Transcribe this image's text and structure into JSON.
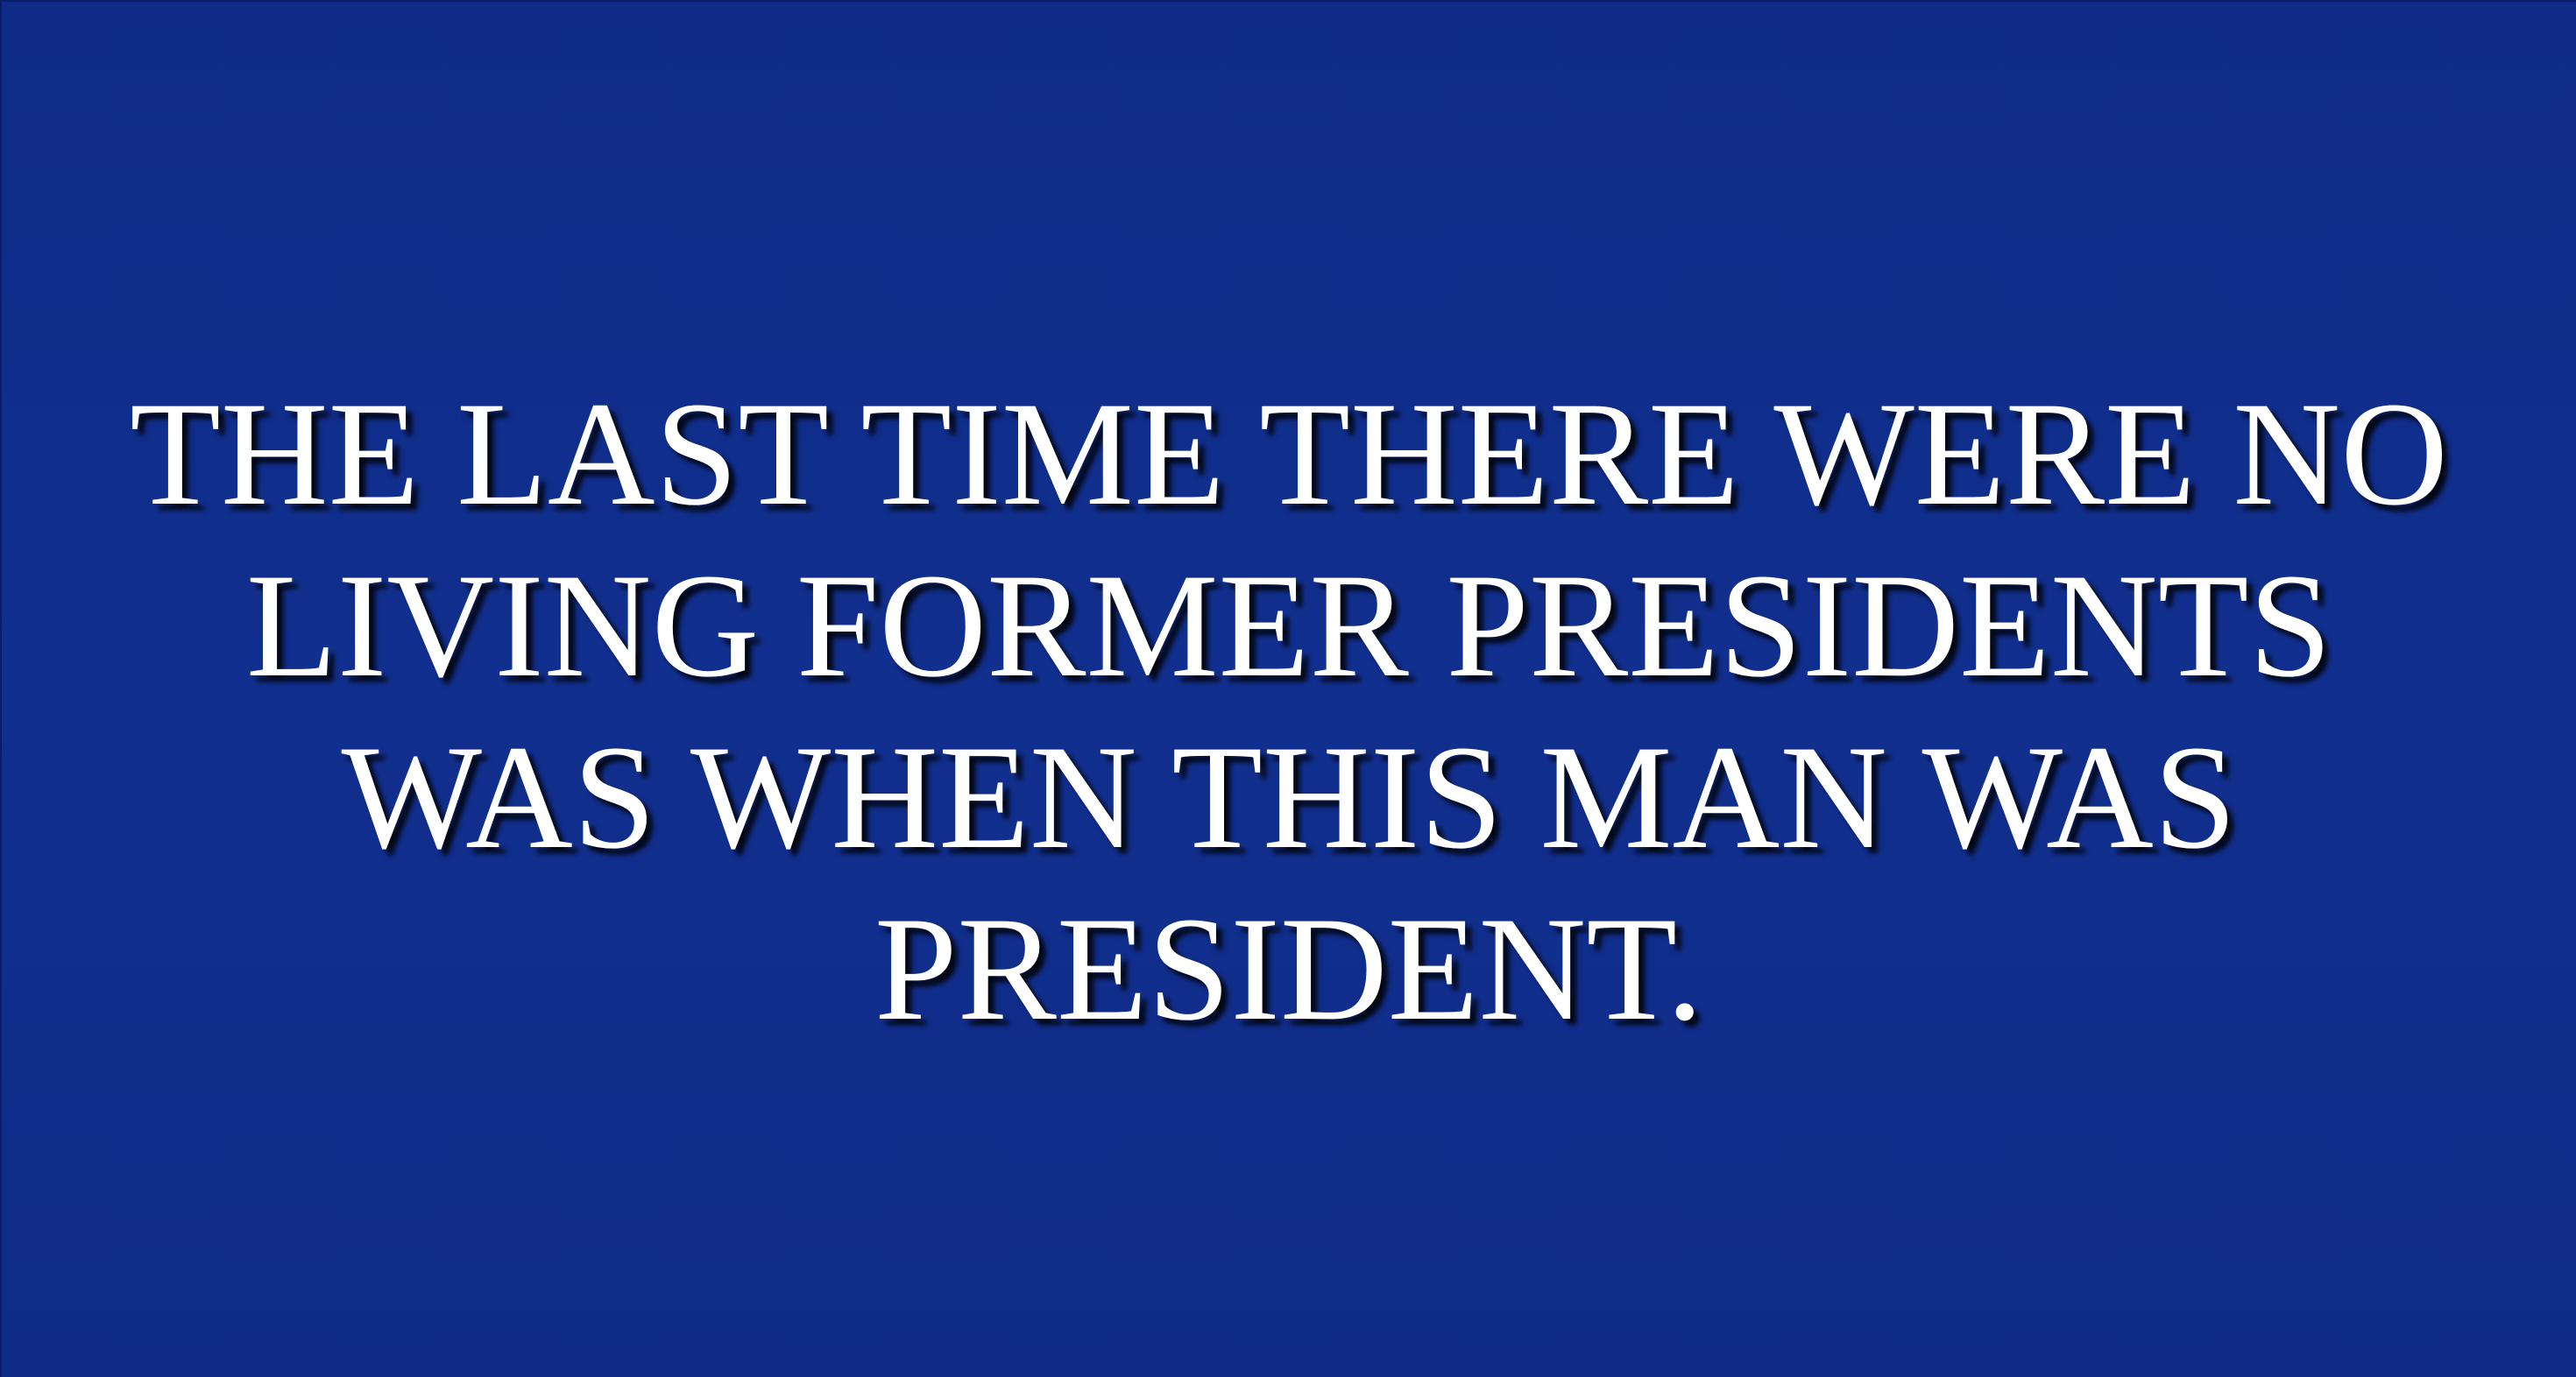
{
  "clue": {
    "lines": [
      "THE LAST TIME THERE WERE NO",
      "LIVING FORMER PRESIDENTS",
      "WAS WHEN THIS MAN WAS",
      "PRESIDENT."
    ]
  },
  "colors": {
    "background": "#0f2b87",
    "text": "#ffffff",
    "shadow": "#000000"
  }
}
